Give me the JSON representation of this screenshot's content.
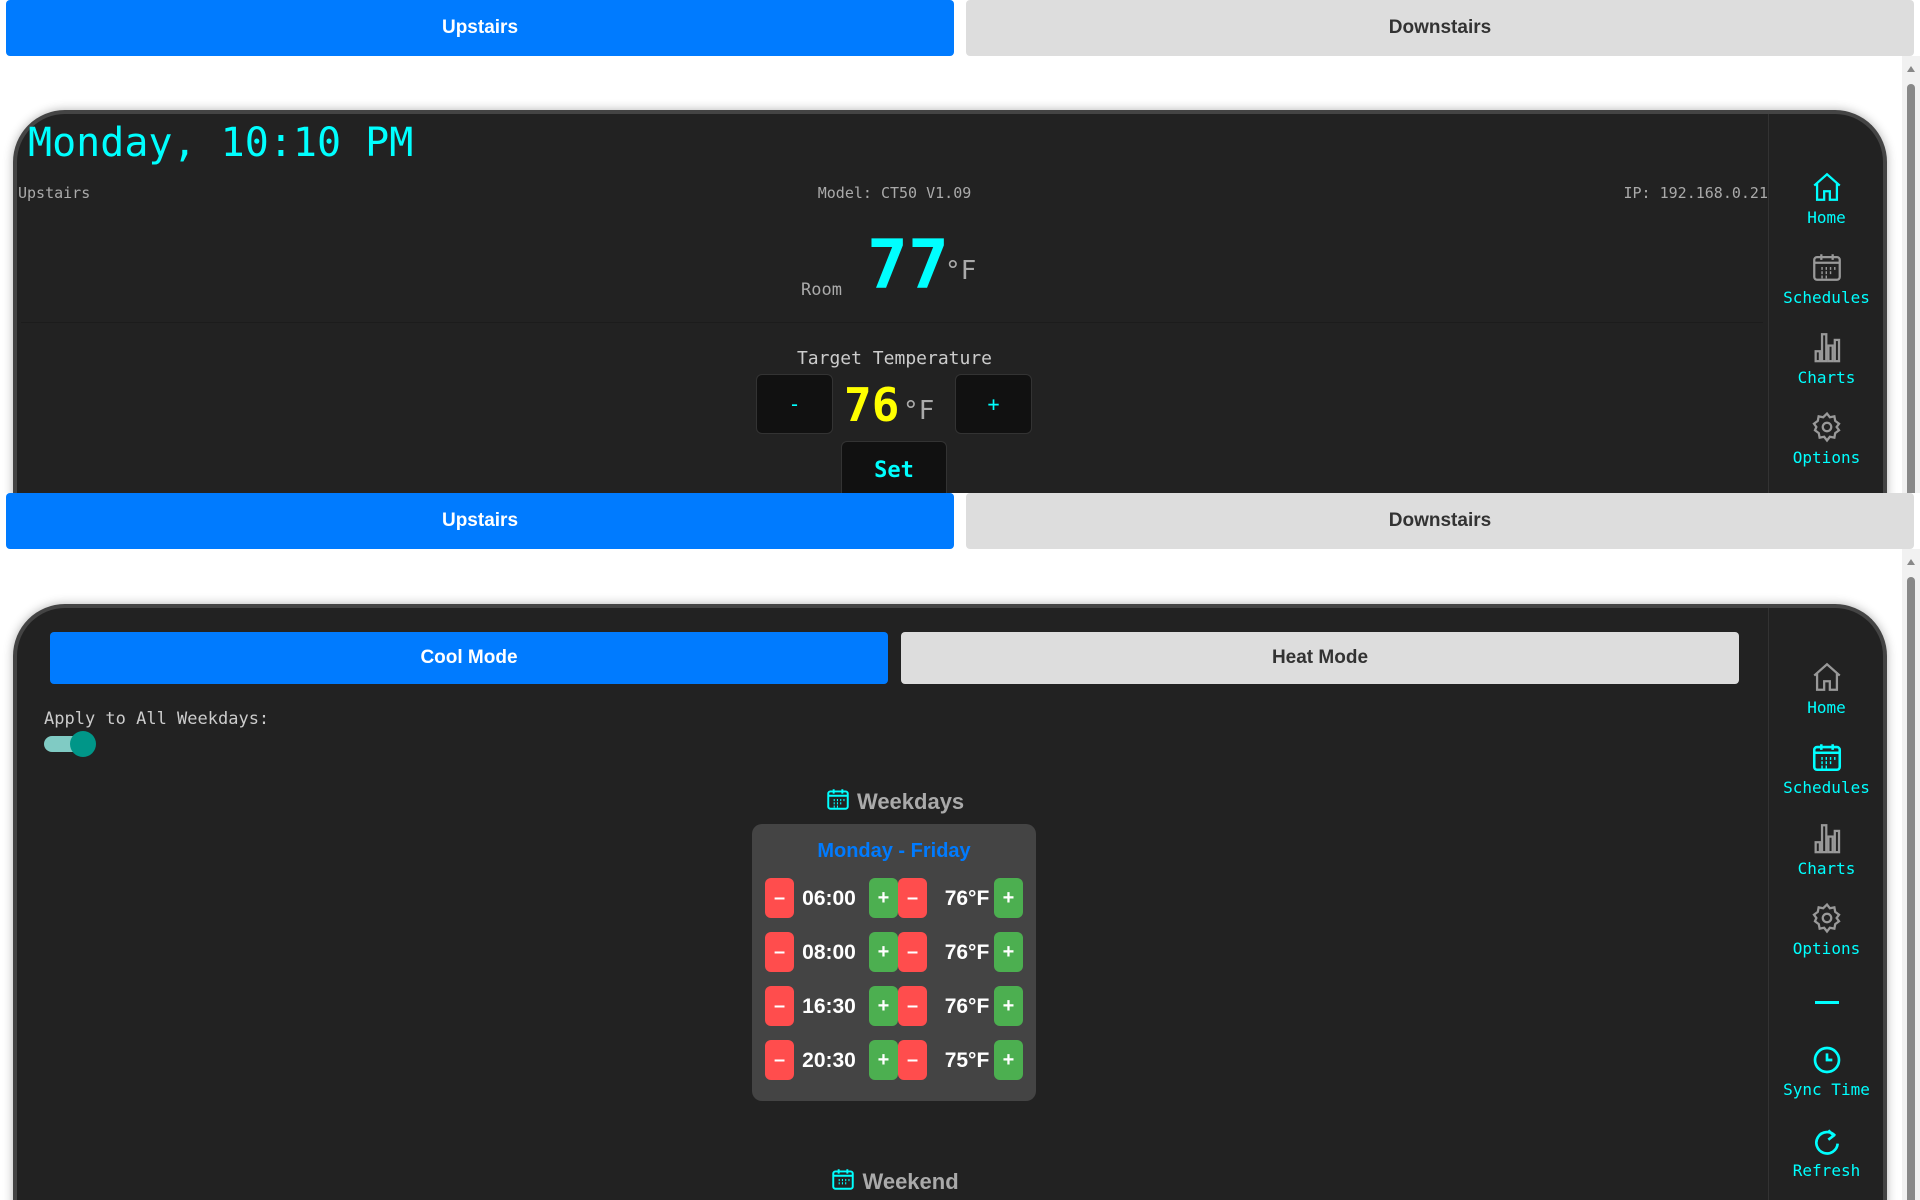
{
  "tabs": {
    "upstairs": "Upstairs",
    "downstairs": "Downstairs"
  },
  "home": {
    "datetime": "Monday, 10:10 PM",
    "location": "Upstairs",
    "model": "Model: CT50 V1.09",
    "ip": "IP: 192.168.0.21",
    "room_label": "Room",
    "room_temp": "77",
    "unit": "°F",
    "target_label": "Target Temperature",
    "target_temp": "76",
    "minus": "-",
    "plus": "+",
    "set": "Set"
  },
  "nav": {
    "home": "Home",
    "schedules": "Schedules",
    "charts": "Charts",
    "options": "Options",
    "sync": "Sync Time",
    "refresh": "Refresh"
  },
  "schedules": {
    "cool_mode": "Cool Mode",
    "heat_mode": "Heat Mode",
    "apply_all": "Apply to All Weekdays:",
    "apply_all_on": true,
    "weekdays_title": "Weekdays",
    "weekdays_range": "Monday - Friday",
    "minus": "–",
    "plus": "+",
    "rows": [
      {
        "time": "06:00",
        "temp": "76°F"
      },
      {
        "time": "08:00",
        "temp": "76°F"
      },
      {
        "time": "16:30",
        "temp": "76°F"
      },
      {
        "time": "20:30",
        "temp": "75°F"
      }
    ],
    "weekend_title": "Weekend"
  },
  "colors": {
    "accent": "#00ffff",
    "primary": "#007bff",
    "target": "#ffff00",
    "decrease": "#ff4d4d",
    "increase": "#4caf50"
  }
}
